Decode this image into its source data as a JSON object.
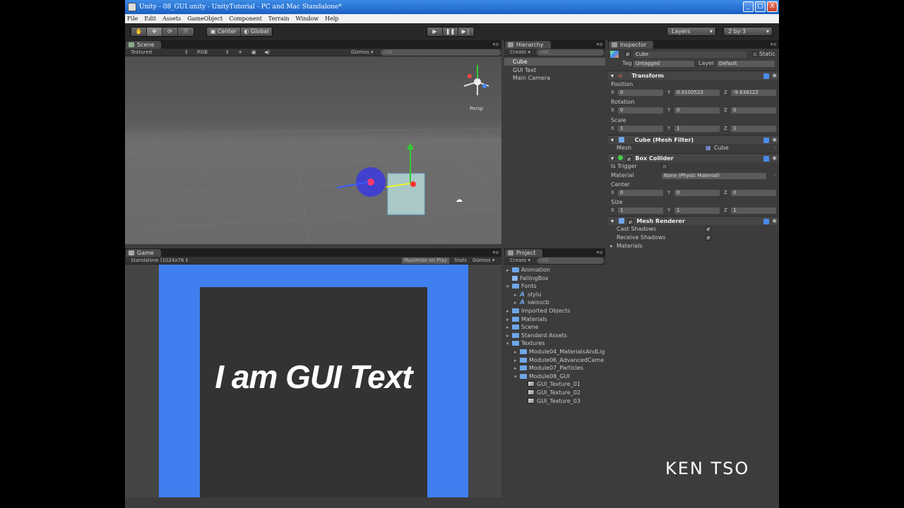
{
  "window": {
    "title": "Unity - 08_GUI.unity - UnityTutorial - PC and Mac Standalone*",
    "controls": {
      "minimize": "_",
      "maximize": "□",
      "close": "X"
    }
  },
  "menu": [
    "File",
    "Edit",
    "Assets",
    "GameObject",
    "Component",
    "Terrain",
    "Window",
    "Help"
  ],
  "toolbar": {
    "tools": [
      "hand-icon",
      "move-icon",
      "rotate-icon",
      "scale-icon"
    ],
    "pivot": "Center",
    "space": "Global",
    "play": [
      "play-icon",
      "pause-icon",
      "step-icon"
    ],
    "layers": "Layers",
    "layout": "2 by 3"
  },
  "scene": {
    "tab": "Scene",
    "render_mode": "Textured",
    "channel": "RGB",
    "gizmos": "Gizmos ▾",
    "search": "All",
    "persp": "Persp"
  },
  "game": {
    "tab": "Game",
    "aspect": "Standalone (1024x76 ‡",
    "maximize": "Maximise on Play",
    "stats": "Stats",
    "gizmos": "Gizmos ▾",
    "gui_text": "I am GUI Text"
  },
  "hierarchy": {
    "tab": "Hierarchy",
    "create": "Create ▾",
    "search": "All",
    "items": [
      "Cube",
      "GUI Text",
      "Main Camera"
    ]
  },
  "project": {
    "tab": "Project",
    "create": "Create ▾",
    "search": "All",
    "items": [
      {
        "label": "Animation",
        "kind": "folder",
        "indent": 0,
        "expanded": false
      },
      {
        "label": "FallingBox",
        "kind": "prefab",
        "indent": 0,
        "expanded": null
      },
      {
        "label": "Fonts",
        "kind": "folder",
        "indent": 0,
        "expanded": true
      },
      {
        "label": "stylu",
        "kind": "font",
        "indent": 1,
        "expanded": false
      },
      {
        "label": "swisscb",
        "kind": "font",
        "indent": 1,
        "expanded": false
      },
      {
        "label": "Imported Objects",
        "kind": "folder",
        "indent": 0,
        "expanded": false
      },
      {
        "label": "Materials",
        "kind": "folder",
        "indent": 0,
        "expanded": false
      },
      {
        "label": "Scene",
        "kind": "folder",
        "indent": 0,
        "expanded": false
      },
      {
        "label": "Standard Assets",
        "kind": "folder",
        "indent": 0,
        "expanded": false
      },
      {
        "label": "Textures",
        "kind": "folder",
        "indent": 0,
        "expanded": true
      },
      {
        "label": "Module04_MaterialsAndLig",
        "kind": "folder",
        "indent": 1,
        "expanded": false
      },
      {
        "label": "Module06_AdvancedCame",
        "kind": "folder",
        "indent": 1,
        "expanded": false
      },
      {
        "label": "Module07_Particles",
        "kind": "folder",
        "indent": 1,
        "expanded": false
      },
      {
        "label": "Module08_GUI",
        "kind": "folder",
        "indent": 1,
        "expanded": true
      },
      {
        "label": "GUI_Texture_01",
        "kind": "texture",
        "indent": 2,
        "expanded": null
      },
      {
        "label": "GUI_Texture_02",
        "kind": "texture",
        "indent": 2,
        "expanded": null
      },
      {
        "label": "GUI_Texture_03",
        "kind": "texture",
        "indent": 2,
        "expanded": null
      }
    ]
  },
  "inspector": {
    "tab": "Inspector",
    "object_name": "Cube",
    "static": "Static",
    "tag_label": "Tag",
    "tag": "Untagged",
    "layer_label": "Layer",
    "layer": "Default",
    "transform": {
      "title": "Transform",
      "position_label": "Position",
      "position": {
        "x": "0",
        "y": "0.9100523",
        "z": "-9.638122"
      },
      "rotation_label": "Rotation",
      "rotation": {
        "x": "0",
        "y": "0",
        "z": "0"
      },
      "scale_label": "Scale",
      "scale": {
        "x": "1",
        "y": "1",
        "z": "1"
      }
    },
    "mesh_filter": {
      "title": "Cube (Mesh Filter)",
      "mesh_label": "Mesh",
      "mesh": "Cube"
    },
    "box_collider": {
      "title": "Box Collider",
      "is_trigger_label": "Is Trigger",
      "material_label": "Material",
      "material": "None (Physic Material)",
      "center_label": "Center",
      "center": {
        "x": "0",
        "y": "0",
        "z": "0"
      },
      "size_label": "Size",
      "size": {
        "x": "1",
        "y": "1",
        "z": "1"
      }
    },
    "mesh_renderer": {
      "title": "Mesh Renderer",
      "cast_shadows_label": "Cast Shadows",
      "receive_shadows_label": "Receive Shadows",
      "materials_label": "Materials"
    },
    "axes": {
      "x": "X",
      "y": "Y",
      "z": "Z"
    }
  },
  "watermark": "KEN TSO",
  "colors": {
    "game_blue": "#3f7ff0",
    "title_blue": "#1b5fc4",
    "folder": "#6fa6e8"
  }
}
